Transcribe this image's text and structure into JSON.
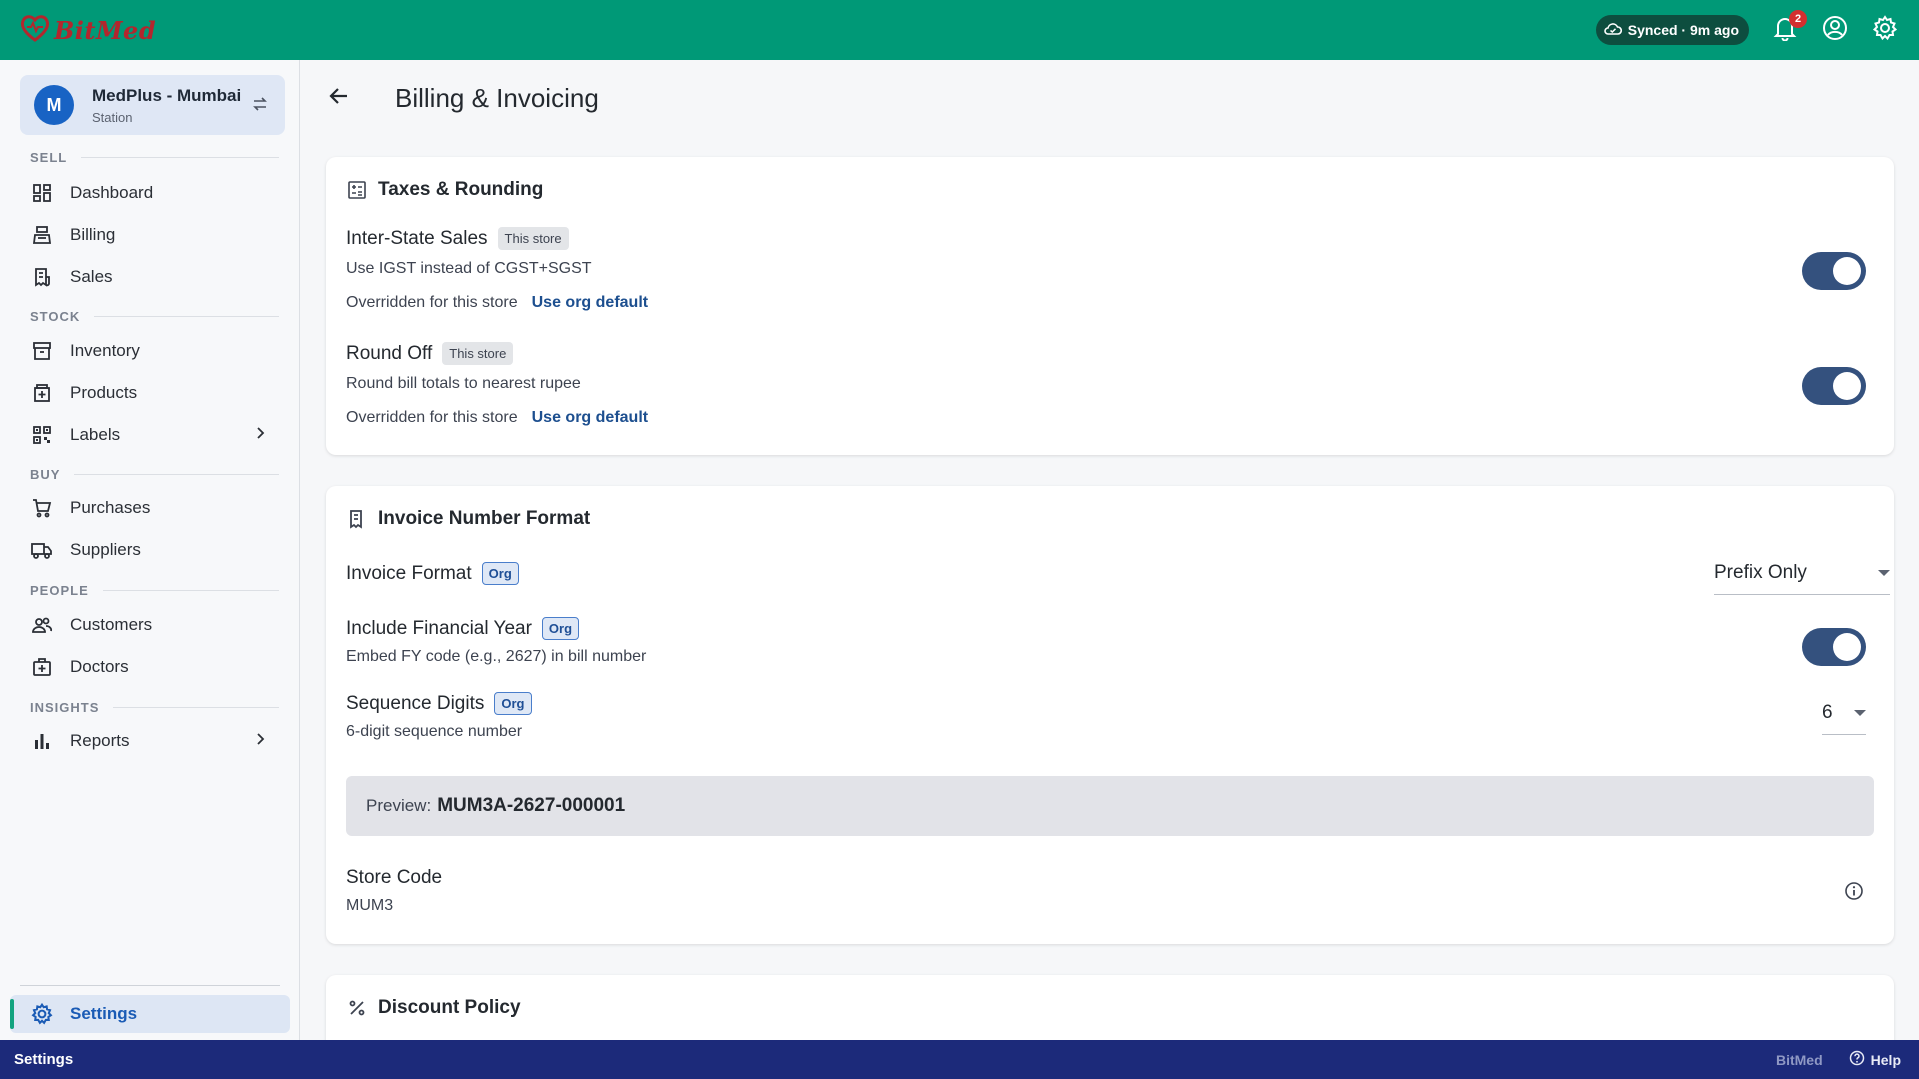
{
  "app": {
    "brand": "BitMed"
  },
  "topbar": {
    "sync_text": "Synced · 9m ago",
    "notification_count": "2"
  },
  "sidebar": {
    "store": {
      "initial": "M",
      "name": "MedPlus - Mumbai",
      "type": "Station"
    },
    "sections": {
      "sell": "SELL",
      "stock": "STOCK",
      "buy": "BUY",
      "people": "PEOPLE",
      "insights": "INSIGHTS"
    },
    "items": {
      "dashboard": "Dashboard",
      "billing": "Billing",
      "sales": "Sales",
      "inventory": "Inventory",
      "products": "Products",
      "labels": "Labels",
      "purchases": "Purchases",
      "suppliers": "Suppliers",
      "customers": "Customers",
      "doctors": "Doctors",
      "reports": "Reports",
      "settings": "Settings"
    }
  },
  "page": {
    "title": "Billing & Invoicing"
  },
  "taxes": {
    "title": "Taxes & Rounding",
    "inter_state": {
      "title": "Inter-State Sales",
      "chip": "This store",
      "desc": "Use IGST instead of CGST+SGST",
      "override": "Overridden for this store",
      "link": "Use org default",
      "enabled": true
    },
    "round_off": {
      "title": "Round Off",
      "chip": "This store",
      "desc": "Round bill totals to nearest rupee",
      "override": "Overridden for this store",
      "link": "Use org default",
      "enabled": true
    }
  },
  "invoice": {
    "title": "Invoice Number Format",
    "format": {
      "title": "Invoice Format",
      "chip": "Org",
      "value": "Prefix Only"
    },
    "financial_year": {
      "title": "Include Financial Year",
      "chip": "Org",
      "desc": "Embed FY code (e.g., 2627) in bill number",
      "enabled": true
    },
    "sequence": {
      "title": "Sequence Digits",
      "chip": "Org",
      "desc": "6-digit sequence number",
      "value": "6"
    },
    "preview_label": "Preview:",
    "preview_value": "MUM3A-2627-000001",
    "store_code": {
      "title": "Store Code",
      "value": "MUM3"
    }
  },
  "discount": {
    "title": "Discount Policy"
  },
  "statusbar": {
    "left": "Settings",
    "brand": "BitMed",
    "help": "Help"
  },
  "colors": {
    "topbar": "#009977",
    "accent": "#1a5bb5",
    "toggle_on": "#34517e",
    "statusbar": "#1c2a7a"
  }
}
